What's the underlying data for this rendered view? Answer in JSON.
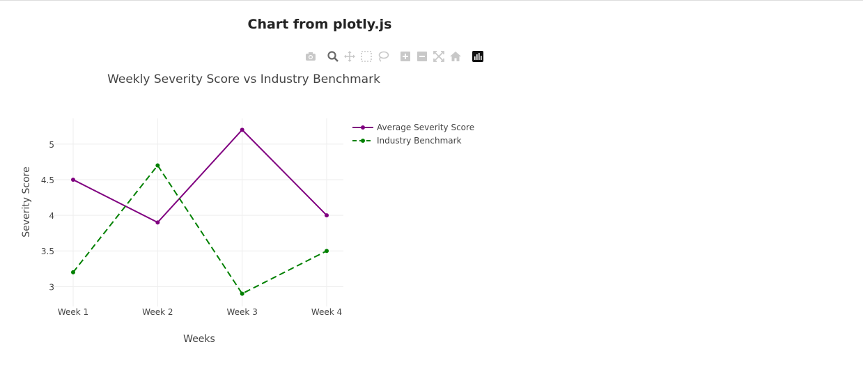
{
  "page": {
    "heading": "Chart from plotly.js"
  },
  "modebar": {
    "buttons": [
      {
        "name": "camera-icon"
      },
      {
        "name": "zoom-icon"
      },
      {
        "name": "pan-icon"
      },
      {
        "name": "box-select-icon"
      },
      {
        "name": "lasso-select-icon"
      },
      {
        "name": "zoom-in-icon"
      },
      {
        "name": "zoom-out-icon"
      },
      {
        "name": "autoscale-icon"
      },
      {
        "name": "reset-axes-icon"
      },
      {
        "name": "plotly-logo-icon"
      }
    ]
  },
  "chart_data": {
    "type": "line",
    "title": "Weekly Severity Score vs Industry Benchmark",
    "xlabel": "Weeks",
    "ylabel": "Severity Score",
    "categories": [
      "Week 1",
      "Week 2",
      "Week 3",
      "Week 4"
    ],
    "ylim": [
      2.72,
      5.36
    ],
    "yticks": [
      3,
      3.5,
      4,
      4.5,
      5
    ],
    "grid": true,
    "legend_position": "top-right",
    "series": [
      {
        "name": "Average Severity Score",
        "values": [
          4.5,
          3.9,
          5.2,
          4.0
        ],
        "color": "#800080",
        "dash": "solid"
      },
      {
        "name": "Industry Benchmark",
        "values": [
          3.2,
          4.7,
          2.9,
          3.5
        ],
        "color": "#008000",
        "dash": "dash"
      }
    ]
  }
}
